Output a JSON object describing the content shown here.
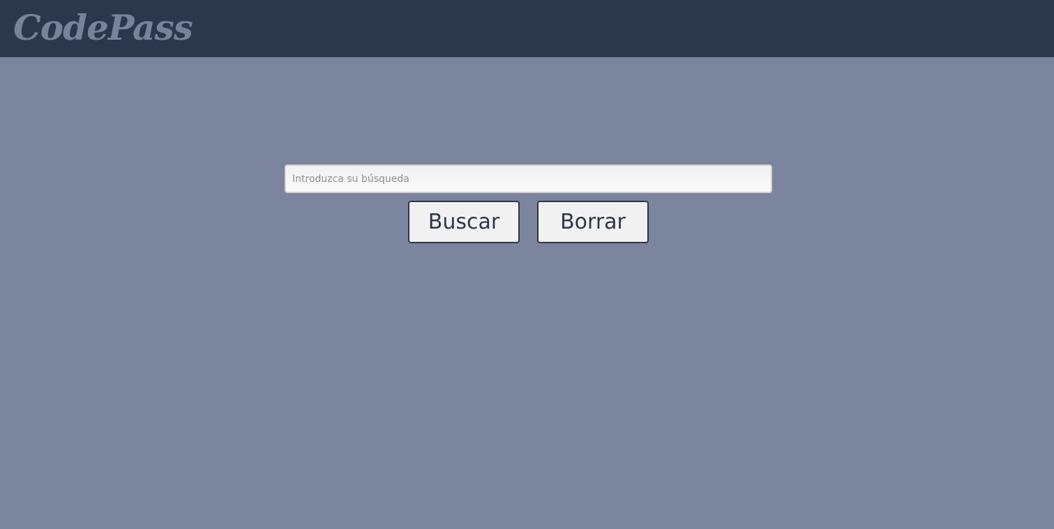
{
  "header": {
    "logo_text": "CodePass",
    "background_color": "#2d374b",
    "logo_color": "#78839a"
  },
  "search": {
    "placeholder": "Introduzca su búsqueda",
    "value": ""
  },
  "actions": {
    "search_label": "Buscar",
    "clear_label": "Borrar"
  },
  "colors": {
    "page_background": "#7b859d",
    "button_background": "#f2f1f1",
    "button_text": "#2d374b"
  }
}
